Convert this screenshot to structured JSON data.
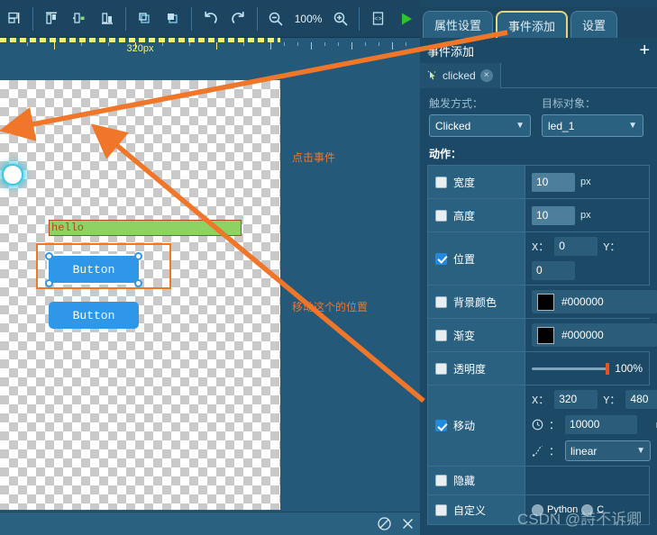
{
  "toolbar": {
    "icons": [
      {
        "name": "align-bottom-icon",
        "title": "align"
      },
      {
        "name": "align-top-distribute-icon",
        "title": "align top"
      },
      {
        "name": "align-center-horizontal-icon",
        "title": "center"
      },
      {
        "name": "align-bottom-edge-icon",
        "title": "align bottom"
      },
      {
        "name": "bring-to-front-icon",
        "title": "bring forward"
      },
      {
        "name": "send-to-back-icon",
        "title": "send backward"
      },
      {
        "name": "undo-icon",
        "title": "undo"
      },
      {
        "name": "redo-icon",
        "title": "redo"
      },
      {
        "name": "zoom-out-icon",
        "title": "zoom out"
      },
      {
        "name": "zoom-in-icon",
        "title": "zoom in"
      },
      {
        "name": "code-icon",
        "title": "view code"
      },
      {
        "name": "run-icon",
        "title": "run"
      }
    ],
    "zoom_level": "100%"
  },
  "ruler": {
    "width_label": "320px"
  },
  "canvas": {
    "led": {
      "label": "",
      "name": "led-widget"
    },
    "label_hello": "hello",
    "button_selected": "Button",
    "button_other": "Button"
  },
  "annotations": {
    "click_event": "点击事件",
    "move_position": "移动这个的位置"
  },
  "bottom_bar": {
    "block_icon": "no-entry-icon",
    "close_icon": "close-icon"
  },
  "right_panel": {
    "tabs": [
      {
        "label": "属性设置",
        "active": false
      },
      {
        "label": "事件添加",
        "active": true
      },
      {
        "label": "设置",
        "active": false
      }
    ],
    "header_title": "事件添加",
    "add_button": "+",
    "event_tabs": [
      {
        "label": "clicked",
        "close": "×"
      }
    ],
    "trigger": {
      "label": "触发方式：",
      "value": "Clicked"
    },
    "target": {
      "label": "目标对象：",
      "value": "led_1"
    },
    "actions_label": "动作：",
    "actions": [
      {
        "name": "宽度",
        "checked": false,
        "kind": "number",
        "value": "10",
        "unit": "px"
      },
      {
        "name": "高度",
        "checked": false,
        "kind": "number",
        "value": "10",
        "unit": "px"
      },
      {
        "name": "位置",
        "checked": true,
        "kind": "xy",
        "x_label": "X：",
        "x": "0",
        "y_label": "Y：",
        "y": "0"
      },
      {
        "name": "背景颜色",
        "checked": false,
        "kind": "color",
        "color": "#000000",
        "hex": "#000000"
      },
      {
        "name": "渐变",
        "checked": false,
        "kind": "color",
        "color": "#000000",
        "hex": "#000000"
      },
      {
        "name": "透明度",
        "checked": false,
        "kind": "slider",
        "percent": "100%"
      },
      {
        "name": "移动",
        "checked": true,
        "kind": "move",
        "x_label": "X：",
        "x": "320",
        "y_label": "Y：",
        "y": "480",
        "duration": "10000",
        "duration_unit": "ms",
        "easing": "linear"
      },
      {
        "name": "隐藏",
        "checked": false,
        "kind": "none"
      },
      {
        "name": "自定义",
        "checked": false,
        "kind": "radio",
        "option_a": "Python",
        "option_b": "C"
      }
    ]
  },
  "watermark": "CSDN @詩不诉卿",
  "colors": {
    "accent_orange": "#f0762a",
    "panel_bg": "#1c4a66",
    "toolbar_bg": "#1b4560",
    "widget_blue": "#2e97e8",
    "label_green": "#8fd264",
    "tab_active_border": "#e8d47a"
  }
}
